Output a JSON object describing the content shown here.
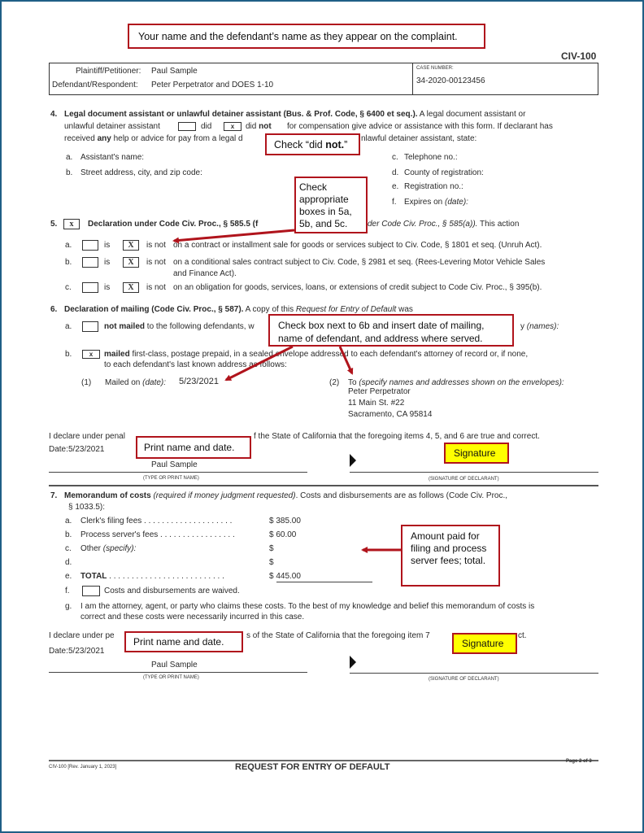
{
  "form_id": "CIV-100",
  "callouts": {
    "names": "Your name and the defendant’s name as they appear on the complaint.",
    "did_not_prefix": "Check “did ",
    "did_not_bold": "not.",
    "did_not_suffix": "”",
    "check_5": [
      "Check",
      "appropriate",
      "boxes in 5a,",
      "5b, and 5c."
    ],
    "check_6b": [
      "Check box next to 6b and insert date of mailing,",
      "name of defendant, and address where served."
    ],
    "print_name_1": "Print name and date.",
    "signature_1": "Signature",
    "amount_paid": [
      "Amount paid for",
      "filing and process",
      "server fees; total."
    ],
    "print_name_2": "Print name and date.",
    "signature_2": "Signature"
  },
  "caption": {
    "plaintiff_label": "Plaintiff/Petitioner:",
    "plaintiff_value": "Paul Sample",
    "defendant_label": "Defendant/Respondent:",
    "defendant_value": "Peter Perpetrator and DOES 1-10",
    "case_number_label": "CASE NUMBER:",
    "case_number_value": "34-2020-00123456"
  },
  "item4": {
    "num": "4.",
    "title": "Legal document assistant or unlawful detainer assistant (Bus. & Prof. Code, § 6400 et seq.).",
    "line1_rest": " A legal document assistant or",
    "line2_a": "unlawful detainer assistant",
    "did": "did",
    "did_checked": "",
    "did_not_checked": "x",
    "did_not_a": "did ",
    "did_not_b": "not",
    "line2_rest": "for compensation give advice or assistance with this form. If declarant has",
    "line3_a": "received ",
    "line3_any": "any",
    "line3_b": " help or advice for pay from a legal d",
    "line3_c": "nlawful detainer assistant, state:",
    "fields_left": [
      {
        "letter": "a.",
        "label": "Assistant's name:"
      },
      {
        "letter": "b.",
        "label": "Street address, city, and zip code:"
      }
    ],
    "fields_right": [
      {
        "letter": "c.",
        "label": "Telephone no.:"
      },
      {
        "letter": "d.",
        "label": "County of registration:"
      },
      {
        "letter": "e.",
        "label": "Registration no.:"
      },
      {
        "letter": "f.",
        "label": "Expires on ",
        "italic": "(date):"
      }
    ]
  },
  "item5": {
    "num": "5.",
    "checked": "x",
    "title": "Declaration under Code Civ. Proc., § 585.5 (f",
    "title_tail": "der Code Civ. Proc., § 585(a)).",
    "title_after": " This action",
    "rows": [
      {
        "letter": "a.",
        "is": "is",
        "is_checked": "",
        "is_not": "is not",
        "is_not_checked": "X",
        "text": "on a contract or installment sale for goods or services subject to Civ. Code, § 1801 et seq. (Unruh Act).",
        "text2": ""
      },
      {
        "letter": "b.",
        "is": "is",
        "is_checked": "",
        "is_not": "is not",
        "is_not_checked": "X",
        "text": "on a conditional sales contract subject to Civ. Code, § 2981 et seq. (Rees-Levering Motor Vehicle Sales",
        "text2": "and Finance Act)."
      },
      {
        "letter": "c.",
        "is": "is",
        "is_checked": "",
        "is_not": "is not",
        "is_not_checked": "X",
        "text": "on an obligation for goods, services, loans, or extensions of credit subject to Code Civ. Proc., § 395(b).",
        "text2": ""
      }
    ]
  },
  "item6": {
    "num": "6.",
    "title": "Declaration of mailing (Code Civ. Proc., § 587).",
    "title_rest_a": " A copy of this ",
    "title_rest_i": "Request for Entry of Default",
    "title_rest_b": " was",
    "a_letter": "a.",
    "a_checked": "",
    "a_bold": "not mailed",
    "a_text": " to the following defendants, w",
    "a_tail_a": "y ",
    "a_tail_i": "(names):",
    "b_letter": "b.",
    "b_checked": "x",
    "b_bold": "mailed",
    "b_text": " first-class, postage prepaid, in a sealed envelope addressed to each defendant's attorney of record or, if none,",
    "b_text2": "to each defendant's last known address as follows:",
    "mailed_num": "(1)",
    "mailed_label": "Mailed on ",
    "mailed_label_i": "(date):",
    "mailed_date": "5/23/2021",
    "to_num": "(2)",
    "to_label": "To ",
    "to_label_i": "(specify names and addresses shown on the envelopes):",
    "address": [
      "Peter Perpetrator",
      "11 Main St. #22",
      "Sacramento, CA 95814"
    ]
  },
  "declaration1": {
    "text_a": "I declare under penal",
    "text_b": "f the State of California that the foregoing items 4, 5, and 6 are true and correct.",
    "date_label": "Date:",
    "date_value": "5/23/2021",
    "printed_name": "Paul Sample",
    "name_caption": "(TYPE OR PRINT NAME)",
    "sig_caption": "(SIGNATURE OF DECLARANT)"
  },
  "item7": {
    "num": "7.",
    "title": "Memorandum of costs",
    "title_i": " (required if money judgment requested)",
    "title_rest": ". Costs and disbursements are as follows (Code Civ. Proc.,",
    "title_line2": "§ 1033.5):",
    "costs": [
      {
        "letter": "a.",
        "label": "Clerk's filing fees",
        "dots": " . . . . . . . . . . . . . . . . . . . .",
        "amount": "$ 385.00"
      },
      {
        "letter": "b.",
        "label": "Process server's fees",
        "dots": " . . . . . . . . . . . . . . . . .",
        "amount": "$ 60.00"
      },
      {
        "letter": "c.",
        "label": "Other ",
        "label_i": "(specify):",
        "dots": "",
        "amount": "$"
      },
      {
        "letter": "d.",
        "label": "",
        "dots": "",
        "amount": "$"
      }
    ],
    "total_letter": "e.",
    "total_label": "TOTAL",
    "total_dots": " . . . . . . . . . . . . . . . . . . . . . . . . . .",
    "total_currency": "$ ",
    "total_amount": "445.00",
    "waived_letter": "f.",
    "waived_checked": "",
    "waived_text": "Costs and disbursements are waived.",
    "g_letter": "g.",
    "g_text": "I am the attorney, agent, or party who claims these costs. To the best of my knowledge and belief this memorandum of costs is",
    "g_text2": "correct and these costs were necessarily incurred in this case."
  },
  "declaration2": {
    "text_a": "I declare under pe",
    "text_b": "s of the State of California that the foregoing item 7",
    "text_c": "ct.",
    "date_label": "Date:",
    "date_value": "5/23/2021",
    "printed_name": "Paul Sample",
    "name_caption": "(TYPE OR PRINT NAME)",
    "sig_caption": "(SIGNATURE OF DECLARANT)"
  },
  "footer": {
    "form_rev": "CIV-100 [Rev. January 1, 2023]",
    "title": "REQUEST FOR ENTRY OF DEFAULT",
    "page": "Page 2 of 3"
  }
}
